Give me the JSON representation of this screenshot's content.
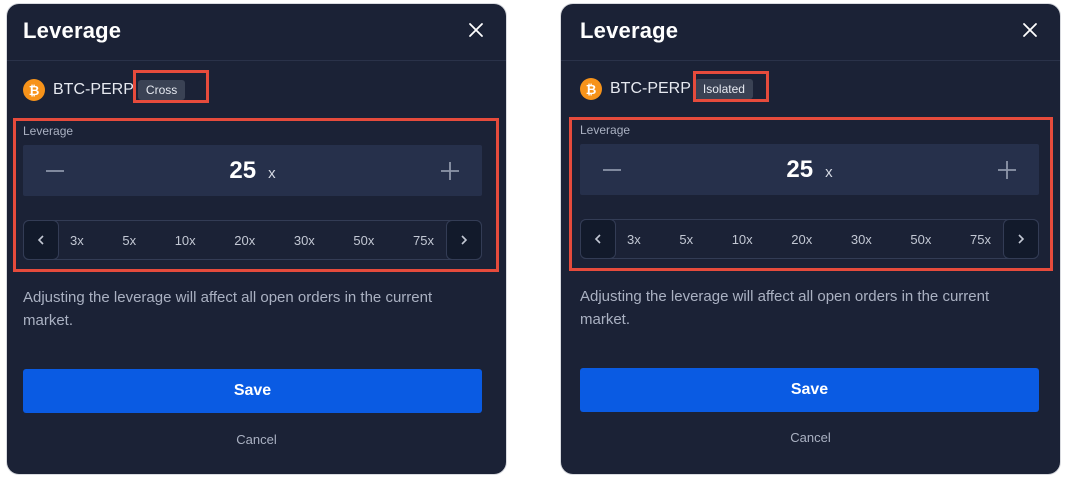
{
  "panels": [
    {
      "title": "Leverage",
      "asset": "BTC-PERP",
      "margin_mode": "Cross",
      "leverage_label": "Leverage",
      "leverage_value": "25",
      "leverage_unit": "x",
      "presets": [
        "3x",
        "5x",
        "10x",
        "20x",
        "30x",
        "50x",
        "75x"
      ],
      "note": "Adjusting the leverage will affect all open orders in the current market.",
      "save_label": "Save",
      "cancel_label": "Cancel"
    },
    {
      "title": "Leverage",
      "asset": "BTC-PERP",
      "margin_mode": "Isolated",
      "leverage_label": "Leverage",
      "leverage_value": "25",
      "leverage_unit": "x",
      "presets": [
        "3x",
        "5x",
        "10x",
        "20x",
        "30x",
        "50x",
        "75x"
      ],
      "note": "Adjusting the leverage will affect all open orders in the current market.",
      "save_label": "Save",
      "cancel_label": "Cancel"
    }
  ],
  "colors": {
    "panel_bg": "#1b2236",
    "stepper_bg": "#26304b",
    "primary": "#0a5be3",
    "highlight": "#e64b3c",
    "bitcoin": "#f7931a"
  },
  "icons": {
    "close": "close-icon",
    "minus": "minus-icon",
    "plus": "plus-icon",
    "prev": "chevron-left-icon",
    "next": "chevron-right-icon",
    "asset": "bitcoin-icon"
  }
}
